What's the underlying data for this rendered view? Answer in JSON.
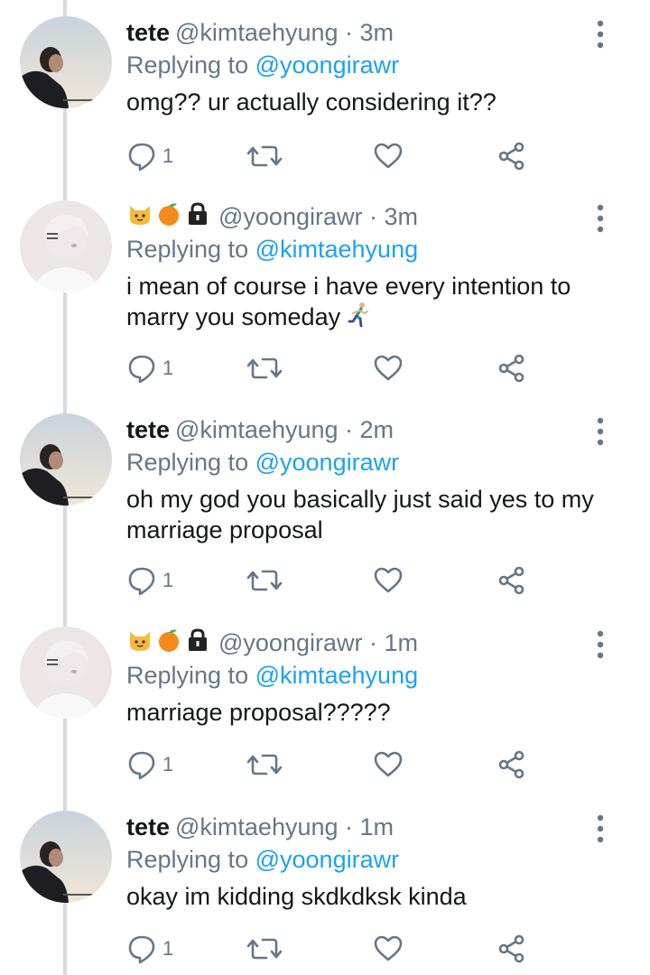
{
  "colors": {
    "link": "#1da1f2",
    "muted": "#657786",
    "text": "#14171a",
    "thread_line": "#d6dbe0"
  },
  "tweets": [
    {
      "display_name": "tete",
      "name_emojis": [],
      "handle": "@kimtaehyung",
      "time": "· 3m",
      "replying_label": "Replying to",
      "replying_to": "@yoongirawr",
      "text": "omg?? ur actually considering it??",
      "has_runner_emoji": false,
      "reply_count": "1",
      "avatar_icon": "avatar-tete"
    },
    {
      "display_name": "",
      "name_emojis": [
        "cat-emoji",
        "tangerine-emoji",
        "lock-emoji"
      ],
      "handle": "@yoongirawr",
      "time": "· 3m",
      "replying_label": "Replying to",
      "replying_to": "@kimtaehyung",
      "text": "i mean of course i have every intention to marry you someday",
      "has_runner_emoji": true,
      "reply_count": "1",
      "avatar_icon": "avatar-yoongi"
    },
    {
      "display_name": "tete",
      "name_emojis": [],
      "handle": "@kimtaehyung",
      "time": "· 2m",
      "replying_label": "Replying to",
      "replying_to": "@yoongirawr",
      "text": "oh my god you basically just said yes to my marriage proposal",
      "has_runner_emoji": false,
      "reply_count": "1",
      "avatar_icon": "avatar-tete"
    },
    {
      "display_name": "",
      "name_emojis": [
        "cat-emoji",
        "tangerine-emoji",
        "lock-emoji"
      ],
      "handle": "@yoongirawr",
      "time": "· 1m",
      "replying_label": "Replying to",
      "replying_to": "@kimtaehyung",
      "text": "marriage proposal?????",
      "has_runner_emoji": false,
      "reply_count": "1",
      "avatar_icon": "avatar-yoongi"
    },
    {
      "display_name": "tete",
      "name_emojis": [],
      "handle": "@kimtaehyung",
      "time": "· 1m",
      "replying_label": "Replying to",
      "replying_to": "@yoongirawr",
      "text": "okay im kidding skdkdksk kinda",
      "has_runner_emoji": false,
      "reply_count": "1",
      "avatar_icon": "avatar-tete"
    }
  ]
}
